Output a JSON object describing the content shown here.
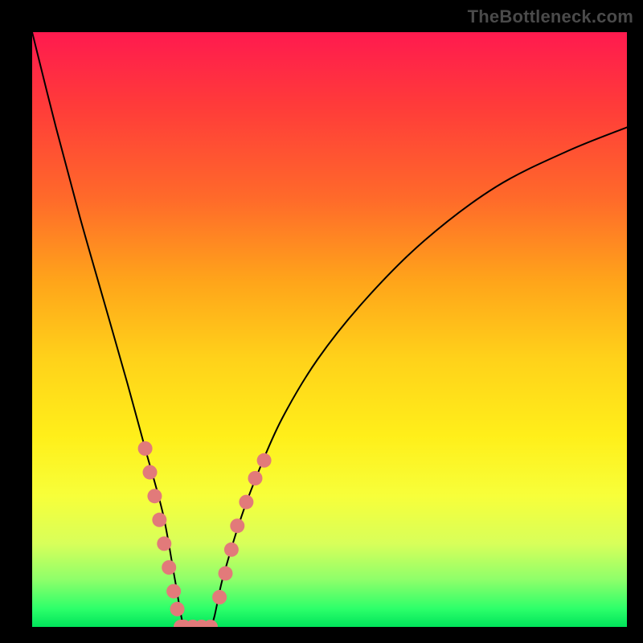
{
  "watermark": {
    "text": "TheBottleneck.com"
  },
  "chart_data": {
    "type": "line",
    "title": "",
    "xlabel": "",
    "ylabel": "",
    "xlim": [
      0,
      100
    ],
    "ylim": [
      0,
      100
    ],
    "legend": false,
    "grid": false,
    "background_gradient": {
      "top": "#ff1a4f",
      "bottom": "#00e35a"
    },
    "curve": {
      "description": "V-shaped bottleneck curve (two branches meeting at a trough)",
      "x": [
        0,
        4,
        8,
        12,
        16,
        19,
        22,
        24,
        25.5,
        27,
        30,
        32,
        35,
        38,
        42,
        48,
        56,
        66,
        78,
        90,
        100
      ],
      "y": [
        100,
        84,
        69,
        55,
        41,
        30,
        19,
        8,
        0,
        0,
        0,
        8,
        18,
        26,
        35,
        45,
        55,
        65,
        74,
        80,
        84
      ]
    },
    "trough_x": 27.5,
    "series": [
      {
        "name": "left-branch-markers",
        "marker": "circle",
        "color": "#e27a7a",
        "x": [
          19.0,
          19.8,
          20.6,
          21.4,
          22.2,
          23.0,
          23.8,
          24.4,
          25.0
        ],
        "y": [
          30,
          26,
          22,
          18,
          14,
          10,
          6,
          3,
          0
        ]
      },
      {
        "name": "trough-markers",
        "marker": "circle",
        "color": "#e27a7a",
        "x": [
          25.5,
          27.0,
          28.5,
          30.0
        ],
        "y": [
          0,
          0,
          0,
          0
        ]
      },
      {
        "name": "right-branch-markers",
        "marker": "circle",
        "color": "#e27a7a",
        "x": [
          31.5,
          32.5,
          33.5,
          34.5,
          36.0,
          37.5,
          39.0
        ],
        "y": [
          5,
          9,
          13,
          17,
          21,
          25,
          28
        ]
      }
    ]
  }
}
